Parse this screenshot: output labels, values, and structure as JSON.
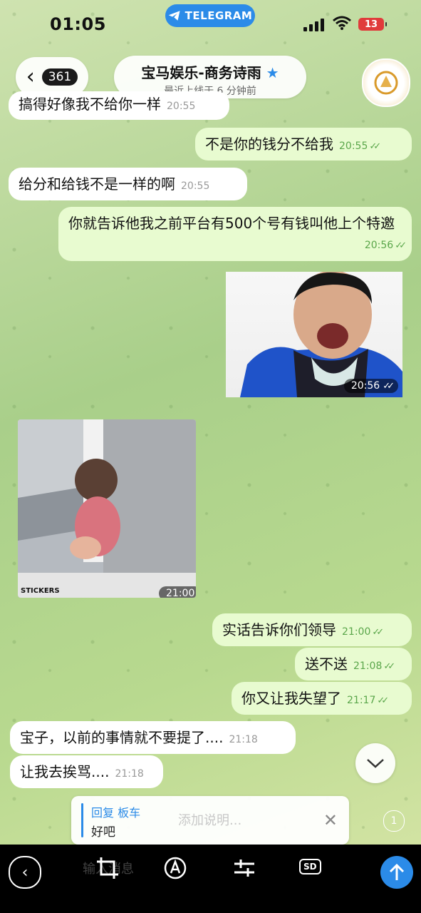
{
  "status": {
    "time": "01:05",
    "app_pill": "TELEGRAM",
    "battery": "13"
  },
  "header": {
    "back_count": "361",
    "contact_name": "宝马娱乐-商务诗雨",
    "last_seen": "最近上线于 6 分钟前",
    "verified_star": "★"
  },
  "messages": [
    {
      "dir": "in",
      "text": "搞得好像我不给你一样",
      "time": "20:55"
    },
    {
      "dir": "out",
      "text": "不是你的钱分不给我",
      "time": "20:55"
    },
    {
      "dir": "in",
      "text": "给分和给钱不是一样的啊",
      "time": "20:55"
    },
    {
      "dir": "out",
      "text": "你就告诉他我之前平台有500个号有钱叫他上个特邀",
      "time": "20:56"
    },
    {
      "dir": "out",
      "type": "sticker",
      "time": "20:56"
    },
    {
      "dir": "in",
      "type": "sticker",
      "time": "21:00",
      "label": "STICKERS"
    },
    {
      "dir": "out",
      "text": "实话告诉你们领导",
      "time": "21:00"
    },
    {
      "dir": "out",
      "text": "送不送",
      "time": "21:08"
    },
    {
      "dir": "out",
      "text": "你又让我失望了",
      "time": "21:17"
    },
    {
      "dir": "in",
      "text": "宝子，以前的事情就不要提了....",
      "time": "21:18"
    },
    {
      "dir": "in",
      "text": "让我去挨骂....",
      "time": "21:18"
    }
  ],
  "reply": {
    "label": "回复 板车",
    "text": "好吧",
    "caption_placeholder": "添加说明...",
    "close": "✕"
  },
  "media_counter": "1",
  "toolbar": {
    "faded_placeholder": "输入消息",
    "sd_label": "SD"
  }
}
